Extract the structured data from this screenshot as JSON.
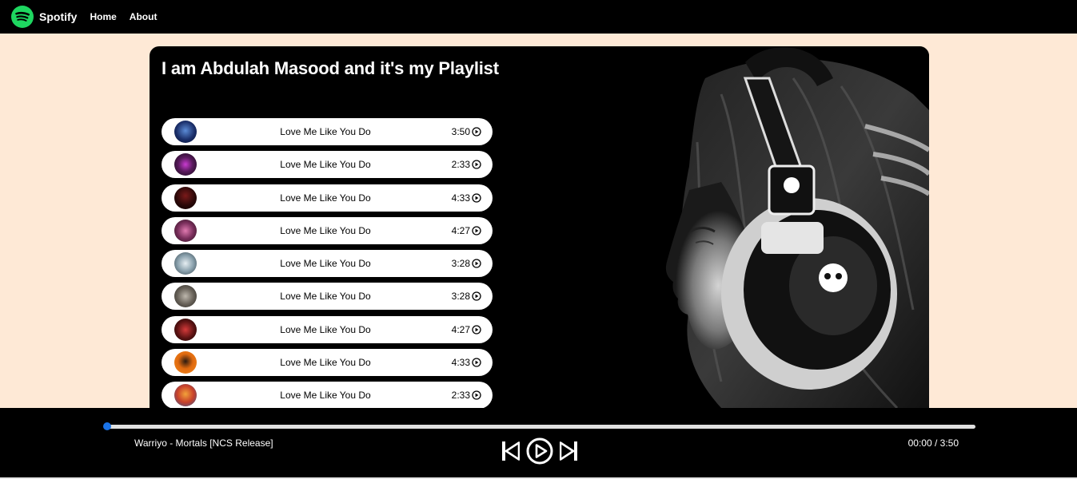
{
  "nav": {
    "brand": "Spotify",
    "links": [
      "Home",
      "About"
    ]
  },
  "playlist": {
    "title": "I am Abdulah Masood and it's my Playlist",
    "songs": [
      {
        "name": "Love Me Like You Do",
        "duration": "3:50"
      },
      {
        "name": "Love Me Like You Do",
        "duration": "2:33"
      },
      {
        "name": "Love Me Like You Do",
        "duration": "4:33"
      },
      {
        "name": "Love Me Like You Do",
        "duration": "4:27"
      },
      {
        "name": "Love Me Like You Do",
        "duration": "3:28"
      },
      {
        "name": "Love Me Like You Do",
        "duration": "3:28"
      },
      {
        "name": "Love Me Like You Do",
        "duration": "4:27"
      },
      {
        "name": "Love Me Like You Do",
        "duration": "4:33"
      },
      {
        "name": "Love Me Like You Do",
        "duration": "2:33"
      }
    ]
  },
  "player": {
    "now_playing": "Warriyo - Mortals [NCS Release]",
    "time": "00:00 / 3:50",
    "progress": 0
  },
  "colors": {
    "background": "#FEE9D6",
    "brand_green": "#1ED760",
    "progress_accent": "#1a73e8"
  },
  "icons": {
    "logo": "spotify-logo",
    "song_play": "play-circle-icon",
    "previous": "skip-previous-icon",
    "play": "play-circle-icon",
    "next": "skip-next-icon"
  }
}
